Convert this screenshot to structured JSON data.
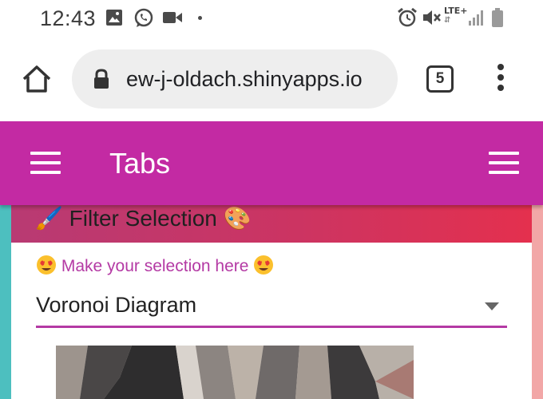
{
  "status_bar": {
    "time": "12:43",
    "network": "LTE+"
  },
  "browser": {
    "url": "ew-j-oldach.shinyapps.io",
    "tab_count": "5"
  },
  "app": {
    "title": "Tabs",
    "header_color": "#c32aa3"
  },
  "filter_card": {
    "title": "Filter Selection",
    "title_emoji_left": "🖌️",
    "title_emoji_right": "🎨",
    "selection_label": "Make your selection here",
    "selected_value": "Voronoi Diagram",
    "accent_color": "#b43aa4"
  }
}
